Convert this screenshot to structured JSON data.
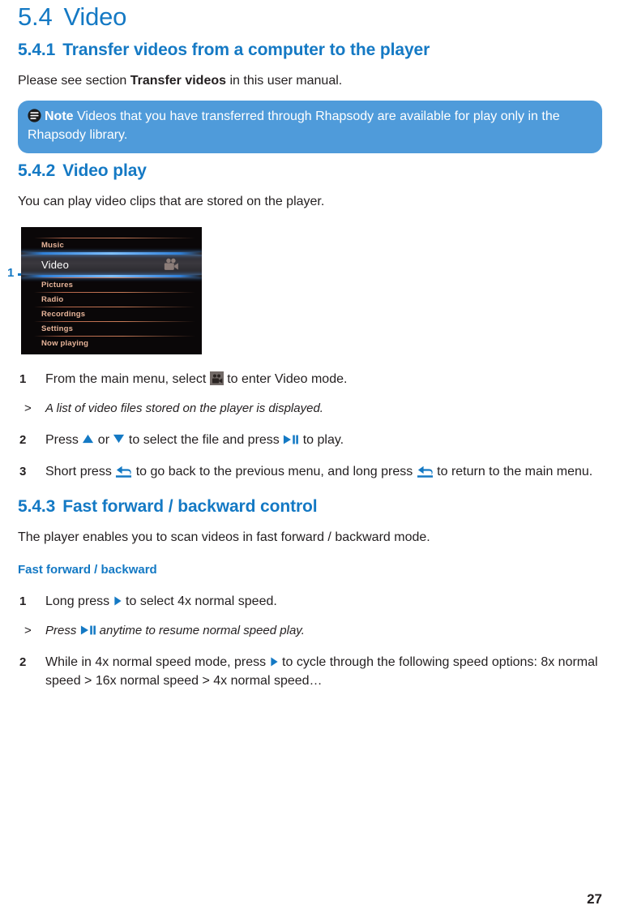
{
  "document": {
    "page_number": "27",
    "colors": {
      "heading_blue": "#1479c4",
      "note_box_blue": "#4f9bda",
      "body_text": "#231f20",
      "device_menu_text": "#e8b59a",
      "device_selected_text": "#ffffff"
    }
  },
  "section_main": {
    "number": "5.4",
    "title": "Video"
  },
  "section_541": {
    "number": "5.4.1",
    "title": "Transfer videos from a computer to the player",
    "paragraph_pre": "Please see section ",
    "paragraph_bold": "Transfer videos",
    "paragraph_post": " in this user manual."
  },
  "note": {
    "icon": "note-list-icon",
    "label": "Note",
    "text": " Videos that you have transferred through Rhapsody are available for play only in the Rhapsody library."
  },
  "section_542": {
    "number": "5.4.2",
    "title": "Video play",
    "paragraph": "You can play video clips that are stored on the player.",
    "callout_label": "1",
    "device_menu": {
      "items": [
        {
          "label": "Music",
          "selected": false,
          "icon": ""
        },
        {
          "label": "Video",
          "selected": true,
          "icon": "video-camera-icon"
        },
        {
          "label": "Pictures",
          "selected": false,
          "icon": ""
        },
        {
          "label": "Radio",
          "selected": false,
          "icon": ""
        },
        {
          "label": "Recordings",
          "selected": false,
          "icon": ""
        },
        {
          "label": "Settings",
          "selected": false,
          "icon": ""
        },
        {
          "label": "Now playing",
          "selected": false,
          "icon": ""
        }
      ]
    },
    "steps": [
      {
        "number": "1",
        "pre": "From the main menu, select ",
        "icon": "video-camera-icon",
        "post": " to enter Video mode."
      },
      {
        "number": "2",
        "pre": "Press ",
        "icon": "up-triangle-icon",
        "mid1": " or ",
        "icon2": "down-triangle-icon",
        "mid2": " to select the file and press ",
        "icon3": "play-pause-icon",
        "post": " to play."
      },
      {
        "number": "3",
        "pre": "Short press ",
        "icon": "back-arrow-icon",
        "mid1": " to go back to the previous menu, and long press ",
        "icon2": "back-arrow-icon",
        "post": " to return to the main menu."
      }
    ],
    "step1_result": {
      "marker": ">",
      "text": "A list of video files stored on the player is displayed."
    }
  },
  "section_543": {
    "number": "5.4.3",
    "title": "Fast forward / backward control",
    "paragraph": "The player enables you to scan videos in fast forward / backward mode.",
    "subheading": "Fast forward / backward",
    "steps": [
      {
        "number": "1",
        "pre": "Long press ",
        "icon": "right-triangle-icon",
        "post": " to select 4x normal speed."
      },
      {
        "number": "2",
        "pre": "While in 4x normal speed mode, press ",
        "icon": "right-triangle-icon",
        "post": " to cycle through the following speed options: 8x normal speed > 16x normal speed > 4x normal speed…"
      }
    ],
    "step1_result": {
      "marker": ">",
      "pre": "Press ",
      "icon": "play-pause-icon",
      "post": " anytime to resume normal speed play."
    }
  }
}
